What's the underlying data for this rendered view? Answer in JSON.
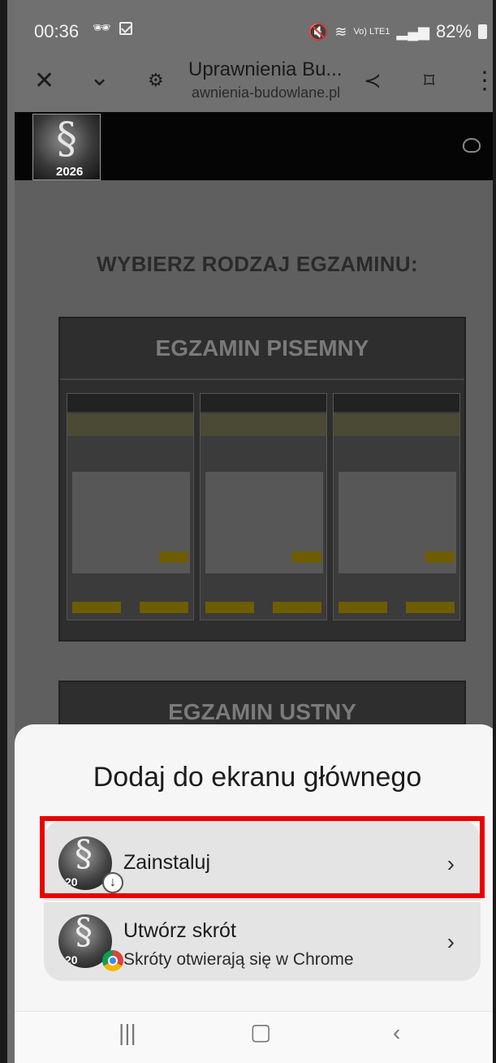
{
  "status_bar": {
    "time": "00:36",
    "battery": "82%",
    "network": "Vo) LTE1"
  },
  "browser": {
    "title": "Uprawnienia Bu...",
    "url": "awnienia-budowlane.pl"
  },
  "page": {
    "logo_year": "2026",
    "choose_heading": "WYBIERZ RODZAJ EGZAMINU:",
    "exam_written": "EGZAMIN PISEMNY",
    "exam_oral": "EGZAMIN USTNY"
  },
  "sheet": {
    "heading": "Dodaj do ekranu głównego",
    "options": [
      {
        "title": "Zainstaluj",
        "icon": "download-badge-icon"
      },
      {
        "title": "Utwórz skrót",
        "subtitle": "Skróty otwierają się w Chrome",
        "icon": "chrome-badge-icon"
      }
    ],
    "icon_year": "20"
  },
  "colors": {
    "highlight": "#ea0000",
    "sheet_bg": "#f6f6f6"
  }
}
